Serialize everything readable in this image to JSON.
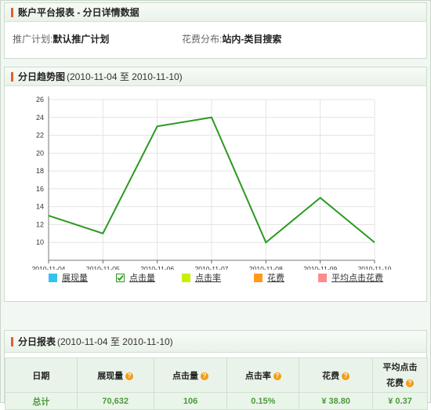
{
  "panel1": {
    "title": "账户平台报表 - 分日详情数据",
    "plan_label": "推广计划:",
    "plan_value": "默认推广计划",
    "dist_label": "花费分布:",
    "dist_value": "站内-类目搜索"
  },
  "panel2": {
    "title": "分日趋势图",
    "range": "(2010-11-04 至 2010-11-10)"
  },
  "chart_data": {
    "type": "line",
    "x": [
      "2010-11-04",
      "2010-11-05",
      "2010-11-06",
      "2010-11-07",
      "2010-11-08",
      "2010-11-09",
      "2010-11-10"
    ],
    "series": [
      {
        "name": "点击量",
        "values": [
          13,
          11,
          23,
          24,
          10,
          15,
          10
        ],
        "color": "#2a9a1f"
      }
    ],
    "yticks": [
      10,
      12,
      14,
      16,
      18,
      20,
      22,
      24,
      26
    ],
    "ylim": [
      8,
      26
    ],
    "grid": true,
    "legend": [
      {
        "label": "展现量",
        "color": "#33c3f0",
        "checked": false
      },
      {
        "label": "点击量",
        "color": "#2a9a1f",
        "checked": true
      },
      {
        "label": "点击率",
        "color": "#c8f000",
        "checked": false
      },
      {
        "label": "花费",
        "color": "#ff9a1a",
        "checked": false
      },
      {
        "label": "平均点击花费",
        "color": "#ff8a8a",
        "checked": false
      }
    ]
  },
  "panel3": {
    "title": "分日报表",
    "range": "(2010-11-04 至 2010-11-10)",
    "headers": [
      "日期",
      "展现量",
      "点击量",
      "点击率",
      "花费",
      "平均点击",
      "花费"
    ],
    "total_row": [
      "总计",
      "70,632",
      "106",
      "0.15%",
      "¥ 38.80",
      "¥ 0.37"
    ]
  },
  "colors": {
    "accent": "#e0622d",
    "line": "#2a9a1f",
    "help": "#f39c12"
  }
}
